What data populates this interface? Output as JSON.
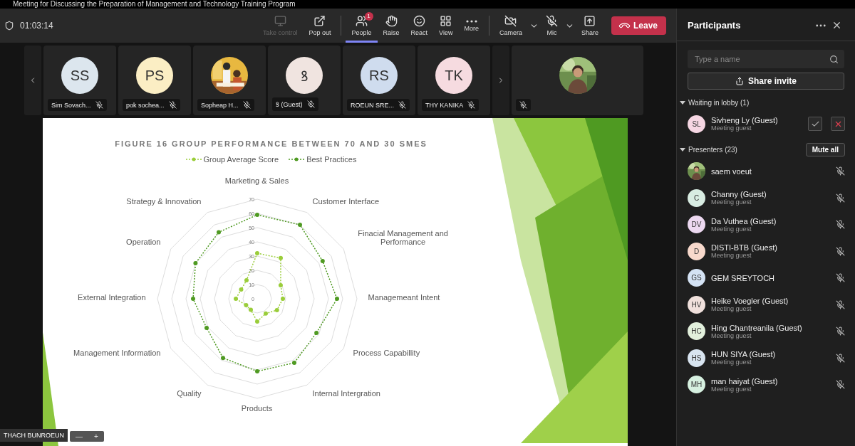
{
  "window": {
    "title": "Meeting for Discussing the Preparation of Management and Technology Training Program"
  },
  "toolbar": {
    "timer": "01:03:14",
    "buttons": [
      {
        "kind": "take_control",
        "label": "Take control",
        "disabled": true,
        "selected": false
      },
      {
        "kind": "pop_out",
        "label": "Pop out",
        "disabled": false,
        "selected": false
      },
      {
        "kind": "people",
        "label": "People",
        "disabled": false,
        "selected": true,
        "badge": "1",
        "divider_before": true
      },
      {
        "kind": "raise",
        "label": "Raise",
        "disabled": false,
        "selected": false
      },
      {
        "kind": "react",
        "label": "React",
        "disabled": false,
        "selected": false
      },
      {
        "kind": "view",
        "label": "View",
        "disabled": false,
        "selected": false
      },
      {
        "kind": "more",
        "label": "More",
        "disabled": false,
        "selected": false
      },
      {
        "kind": "camera",
        "label": "Camera",
        "disabled": false,
        "selected": false,
        "caret": true,
        "divider_before": true
      },
      {
        "kind": "mic",
        "label": "Mic",
        "disabled": false,
        "selected": false,
        "caret": true
      },
      {
        "kind": "share",
        "label": "Share",
        "disabled": false,
        "selected": false
      }
    ],
    "leave": "Leave"
  },
  "thumbnails": [
    {
      "kind": "initials",
      "initials": "SS",
      "name": "Sim Sovach...",
      "color": "#dce6ee"
    },
    {
      "kind": "initials",
      "initials": "PS",
      "name": "pok sochea...",
      "color": "#fbeec4"
    },
    {
      "kind": "picture",
      "name": "Sopheap H..."
    },
    {
      "kind": "initials",
      "initials": "ꝸ",
      "name": "ꝸ (Guest)",
      "color": "#f0e4e0"
    },
    {
      "kind": "initials",
      "initials": "RS",
      "name": "ROEUN SRE...",
      "color": "#cfdcee"
    },
    {
      "kind": "initials",
      "initials": "TK",
      "name": "THY KANIKA",
      "color": "#f6dbe0"
    },
    {
      "kind": "picture_wide"
    }
  ],
  "stage": {
    "presenter": "THACH BUNROEUN",
    "zoom_controls": [
      "—",
      "+"
    ],
    "slide": {
      "chart_data": {
        "type": "radar",
        "title": "FIGURE 16 GROUP PERFORMANCE BETWEEN 70 AND 30 SMES",
        "categories": [
          "Marketing & Sales",
          "Customer Interface",
          "Finacial Management and Performance",
          "Managemeant Intent",
          "Process Capabillity",
          "Internal Intergration",
          "Products",
          "Quality",
          "Management Information",
          "External Integration",
          "Operation",
          "Strategy & Innovation"
        ],
        "series": [
          {
            "name": "Group Average Score",
            "color": "#9acd3a",
            "values": [
              32,
              33,
              19,
              18,
              16,
              12,
              16,
              9,
              9,
              15,
              13,
              15
            ]
          },
          {
            "name": "Best Practices",
            "color": "#4f9a22",
            "values": [
              59,
              60,
              53,
              56,
              48,
              52,
              51,
              48,
              41,
              45,
              50,
              54
            ]
          }
        ],
        "ylim": [
          0,
          70
        ],
        "yticks": [
          0,
          10,
          20,
          30,
          40,
          50,
          60,
          70
        ]
      }
    }
  },
  "participants": {
    "title": "Participants",
    "search": {
      "placeholder": "Type a name"
    },
    "share_button": "Share invite",
    "sections": [
      {
        "kind": "lobby",
        "label": "Waiting in lobby (1)",
        "expanded": true,
        "items": [
          {
            "kind": "initials",
            "initials": "SL",
            "name": "Sivheng Ly (Guest)",
            "subtitle": "Meeting guest",
            "color": "#f6d6e3"
          }
        ]
      },
      {
        "kind": "presenters",
        "label": "Presenters (23)",
        "expanded": true,
        "action": "Mute all",
        "items": [
          {
            "kind": "picture",
            "name": "saem voeut",
            "muted": true
          },
          {
            "kind": "initials",
            "initials": "C",
            "name": "Channy (Guest)",
            "subtitle": "Meeting guest",
            "color": "#d8ece2",
            "muted": true
          },
          {
            "kind": "initials",
            "initials": "DV",
            "name": "Da Vuthea (Guest)",
            "subtitle": "Meeting guest",
            "color": "#ecd8f0",
            "muted": true
          },
          {
            "kind": "initials",
            "initials": "D",
            "name": "DISTI-BTB (Guest)",
            "subtitle": "Meeting guest",
            "color": "#f8d9cc",
            "muted": true
          },
          {
            "kind": "initials",
            "initials": "GS",
            "name": "GEM SREYTOCH",
            "color": "#d4e2f4",
            "muted": true
          },
          {
            "kind": "initials",
            "initials": "HV",
            "name": "Heike Voegler (Guest)",
            "subtitle": "Meeting guest",
            "color": "#f0e0dc",
            "muted": true
          },
          {
            "kind": "initials",
            "initials": "HC",
            "name": "Hing Chantreanila (Guest)",
            "subtitle": "Meeting guest",
            "color": "#e2f0dc",
            "muted": true
          },
          {
            "kind": "initials",
            "initials": "HS",
            "name": "HUN SIYA (Guest)",
            "subtitle": "Meeting guest",
            "color": "#d8e4f0",
            "muted": true
          },
          {
            "kind": "initials",
            "initials": "MH",
            "name": "man haiyat (Guest)",
            "subtitle": "Meeting guest",
            "color": "#d6f0e0",
            "muted": true
          }
        ]
      }
    ]
  }
}
